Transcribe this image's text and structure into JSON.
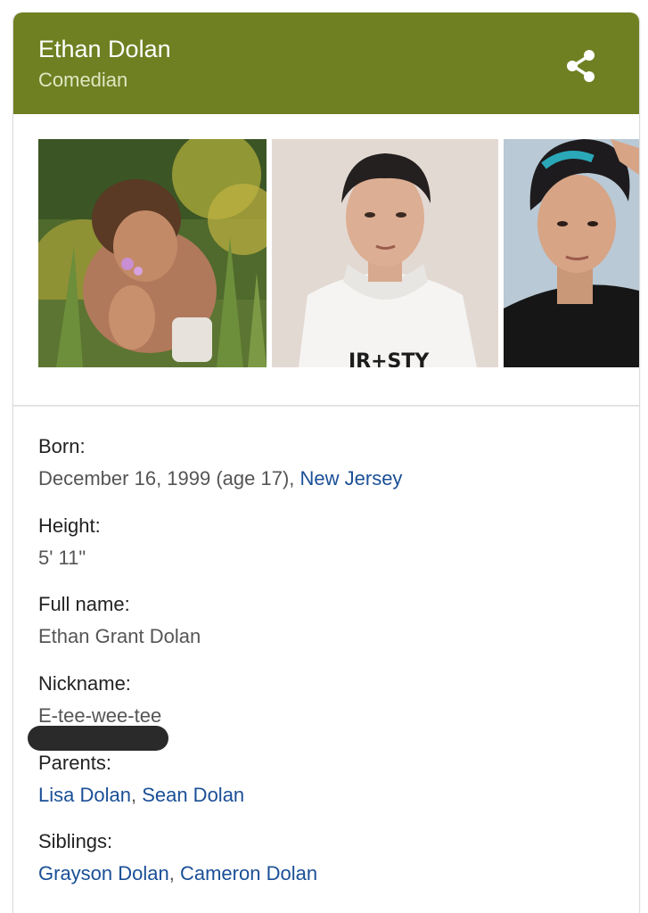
{
  "header": {
    "title": "Ethan Dolan",
    "subtitle": "Comedian",
    "accent_color": "#6e8022",
    "share_icon": "share-icon"
  },
  "images": [
    {
      "name": "photo-flowers"
    },
    {
      "name": "photo-white-hoodie"
    },
    {
      "name": "photo-blue-hair"
    }
  ],
  "facts": {
    "born": {
      "label": "Born:",
      "date": "December 16, 1999 (age 17), ",
      "place": "New Jersey"
    },
    "height": {
      "label": "Height:",
      "value": "5' 11\""
    },
    "full_name": {
      "label": "Full name:",
      "value": "Ethan Grant Dolan"
    },
    "nickname": {
      "label": "Nickname:",
      "value": "E-tee-wee-tee"
    },
    "parents": {
      "label": "Parents:",
      "links": [
        "Lisa Dolan",
        "Sean Dolan"
      ],
      "separator": ", "
    },
    "siblings": {
      "label": "Siblings:",
      "links": [
        "Grayson Dolan",
        "Cameron Dolan"
      ],
      "separator": ", "
    }
  },
  "link_color": "#1a4f96"
}
